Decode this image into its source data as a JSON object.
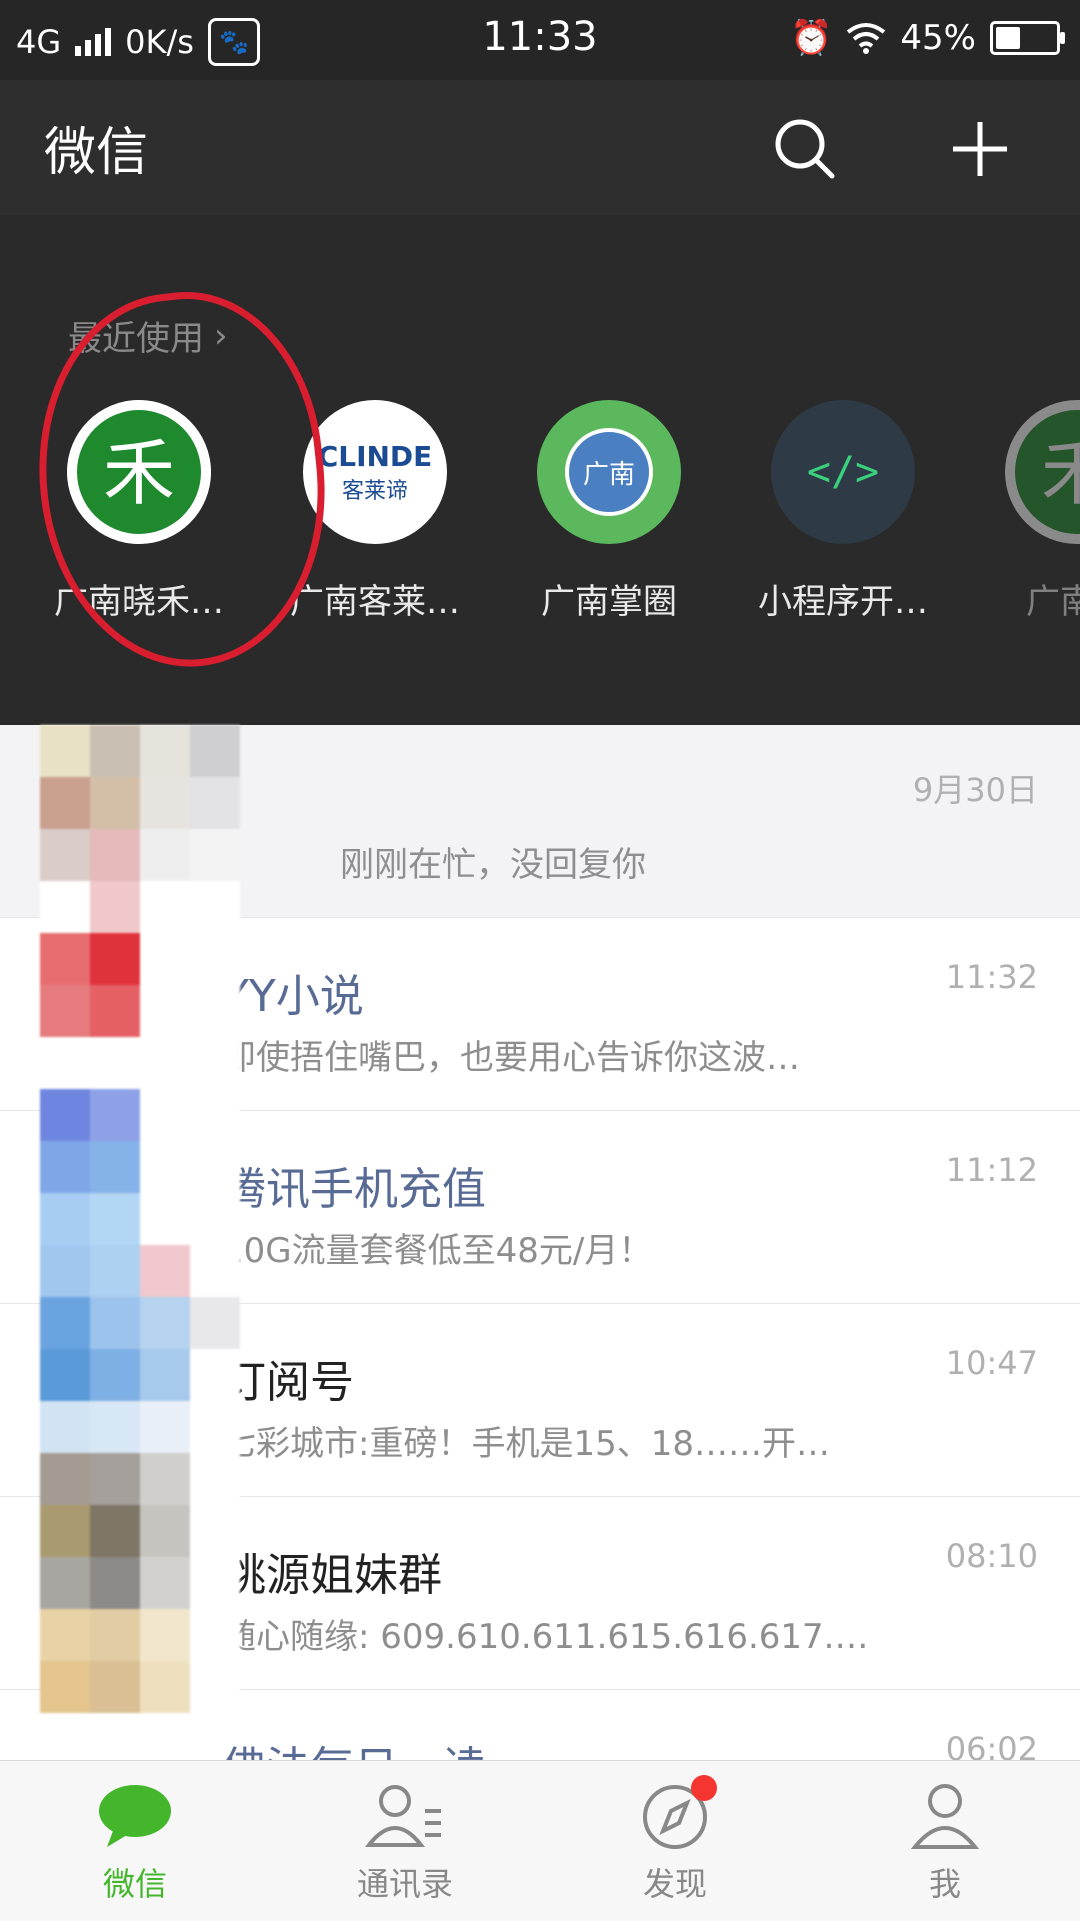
{
  "status_bar": {
    "network": "4G",
    "speed": "0K/s",
    "time": "11:33",
    "battery": "45%",
    "battery_level": 0.45,
    "icons": [
      "signal-icon",
      "baidu-paw-icon",
      "alarm-icon",
      "wifi-icon",
      "battery-icon"
    ]
  },
  "header": {
    "title": "微信",
    "icons": [
      "search-icon",
      "plus-icon"
    ]
  },
  "recent": {
    "label": "最近使用",
    "apps": [
      {
        "name": "广南晓禾…",
        "icon": "he-logo",
        "color": "#1f8a2d"
      },
      {
        "name": "广南客莱…",
        "icon": "clinde-logo",
        "brand_text": "CLINDE",
        "brand_sub": "客莱谛",
        "color": "#1b4b93"
      },
      {
        "name": "广南掌圈",
        "icon": "gnzq-logo",
        "brand_text": "广南",
        "color": "#4caf50"
      },
      {
        "name": "小程序开…",
        "icon": "code-icon",
        "brand_text": "</>",
        "color": "#3ad17c"
      },
      {
        "name": "广南晓",
        "icon": "he-logo",
        "color": "#1f8a2d"
      }
    ]
  },
  "chats": [
    {
      "name": "",
      "message": "刚刚在忙，没回复你",
      "time": "9月30日",
      "pinned": true
    },
    {
      "name": "YY小说",
      "message": "即使捂住嘴巴，也要用心告诉你这波…",
      "time": "11:32",
      "official": true
    },
    {
      "name": "腾讯手机充值",
      "message": "10G流量套餐低至48元/月！",
      "time": "11:12",
      "official": true
    },
    {
      "name": "订阅号",
      "message": "七彩城市:重磅！手机是15、18……开…",
      "time": "10:47",
      "official": false
    },
    {
      "name": "桃源姐妹群",
      "message": "随心随缘: 609.610.611.615.616.617.…",
      "time": "08:10",
      "official": false
    },
    {
      "name": "佛法每日一读",
      "message": "",
      "time": "06:02",
      "official": true
    }
  ],
  "tabs": [
    {
      "label": "微信",
      "icon": "chat-bubble-icon",
      "active": true
    },
    {
      "label": "通讯录",
      "icon": "contacts-icon",
      "active": false
    },
    {
      "label": "发现",
      "icon": "compass-icon",
      "active": false,
      "badge": true
    },
    {
      "label": "我",
      "icon": "person-icon",
      "active": false
    }
  ],
  "colors": {
    "accent": "#43b62c",
    "header": "#2e2e2e",
    "badge": "#f43530",
    "official_name": "#576b95"
  }
}
